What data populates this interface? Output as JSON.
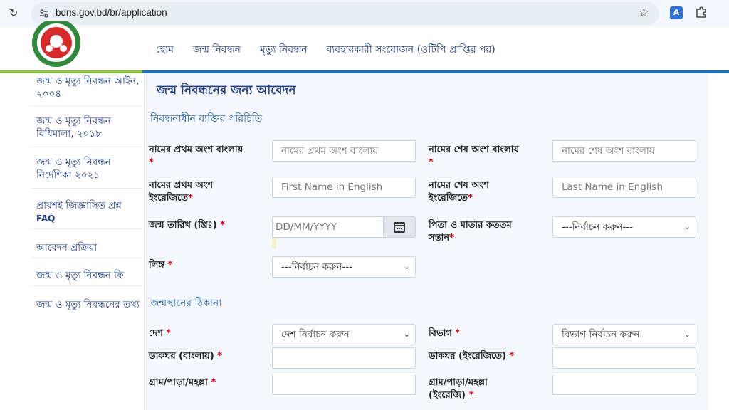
{
  "browser": {
    "url": "bdris.gov.bd/br/application"
  },
  "colors": {
    "brand_blue": "#1f3b84",
    "accent_blue": "#1e6fc5",
    "accent_green": "#8cc43f",
    "required_red": "#d0021b",
    "panel_bg": "#f4f7fb"
  },
  "header": {
    "nav": [
      "হোম",
      "জন্ম নিবন্ধন",
      "মৃত্যু নিবন্ধন",
      "ব্যবহারকারী সংযোজন (ওটিপি প্রাপ্তির পর)"
    ]
  },
  "sidebar": {
    "items": [
      {
        "label": "জন্ম ও মৃত্যু নিবন্ধন আইন, ২০০৪"
      },
      {
        "label": "জন্ম ও মৃত্যু নিবন্ধন বিধিমালা, ২০১৮"
      },
      {
        "label": "জন্ম ও মৃত্যু নিবন্ধন নির্দেশিকা ২০২১"
      },
      {
        "label": "প্রায়শই জিজ্ঞাসিত প্রশ্ন",
        "sub": "FAQ"
      },
      {
        "label": "আবেদন প্রক্রিয়া"
      },
      {
        "label": "জন্ম ও মৃত্যু নিবন্ধন ফি"
      },
      {
        "label": "জন্ম ও মৃত্যু নিবন্ধনের তথ্য"
      }
    ]
  },
  "form": {
    "title": "জন্ম নিবন্ধনের জন্য আবেদন",
    "section_person": "নিবন্ধনাধীন ব্যক্তির পরিচিতি",
    "section_birthplace": "জন্মস্থানের ঠিকানা",
    "required_mark": "*",
    "fields": {
      "first_name_bn": {
        "label": "নামের প্রথম অংশ বাংলায়",
        "placeholder": "নামের প্রথম অংশ বাংলায়"
      },
      "last_name_bn": {
        "label": "নামের শেষ অংশ বাংলায়",
        "placeholder": "নামের শেষ অংশ বাংলায়"
      },
      "first_name_en": {
        "label": "নামের প্রথম অংশ ইংরেজিতে",
        "placeholder": "First Name in English"
      },
      "last_name_en": {
        "label": "নামের শেষ অংশ ইংরেজিতে",
        "placeholder": "Last Name in English"
      },
      "dob": {
        "label": "জন্ম তারিখ (খ্রিঃ)",
        "placeholder": "DD/MM/YYYY"
      },
      "birth_order": {
        "label": "পিতা ও মাতার কততম সন্তান",
        "selected": "---নির্বাচন করুন---"
      },
      "gender": {
        "label": "লিঙ্গ",
        "selected": "---নির্বাচন করুন---"
      },
      "country": {
        "label": "দেশ",
        "selected": "দেশ নির্বাচন করুন"
      },
      "division": {
        "label": "বিভাগ",
        "selected": "বিভাগ নির্বাচন করুন"
      },
      "post_office_bn": {
        "label": "ডাকঘর (বাংলায়)",
        "value": ""
      },
      "post_office_en": {
        "label": "ডাকঘর (ইংরেজিতে)",
        "value": ""
      },
      "village_bn": {
        "label": "গ্রাম/পাড়া/মহল্লা",
        "value": ""
      },
      "village_en": {
        "label": "গ্রাম/পাড়া/মহল্লা (ইংরেজি)",
        "value": ""
      }
    }
  }
}
